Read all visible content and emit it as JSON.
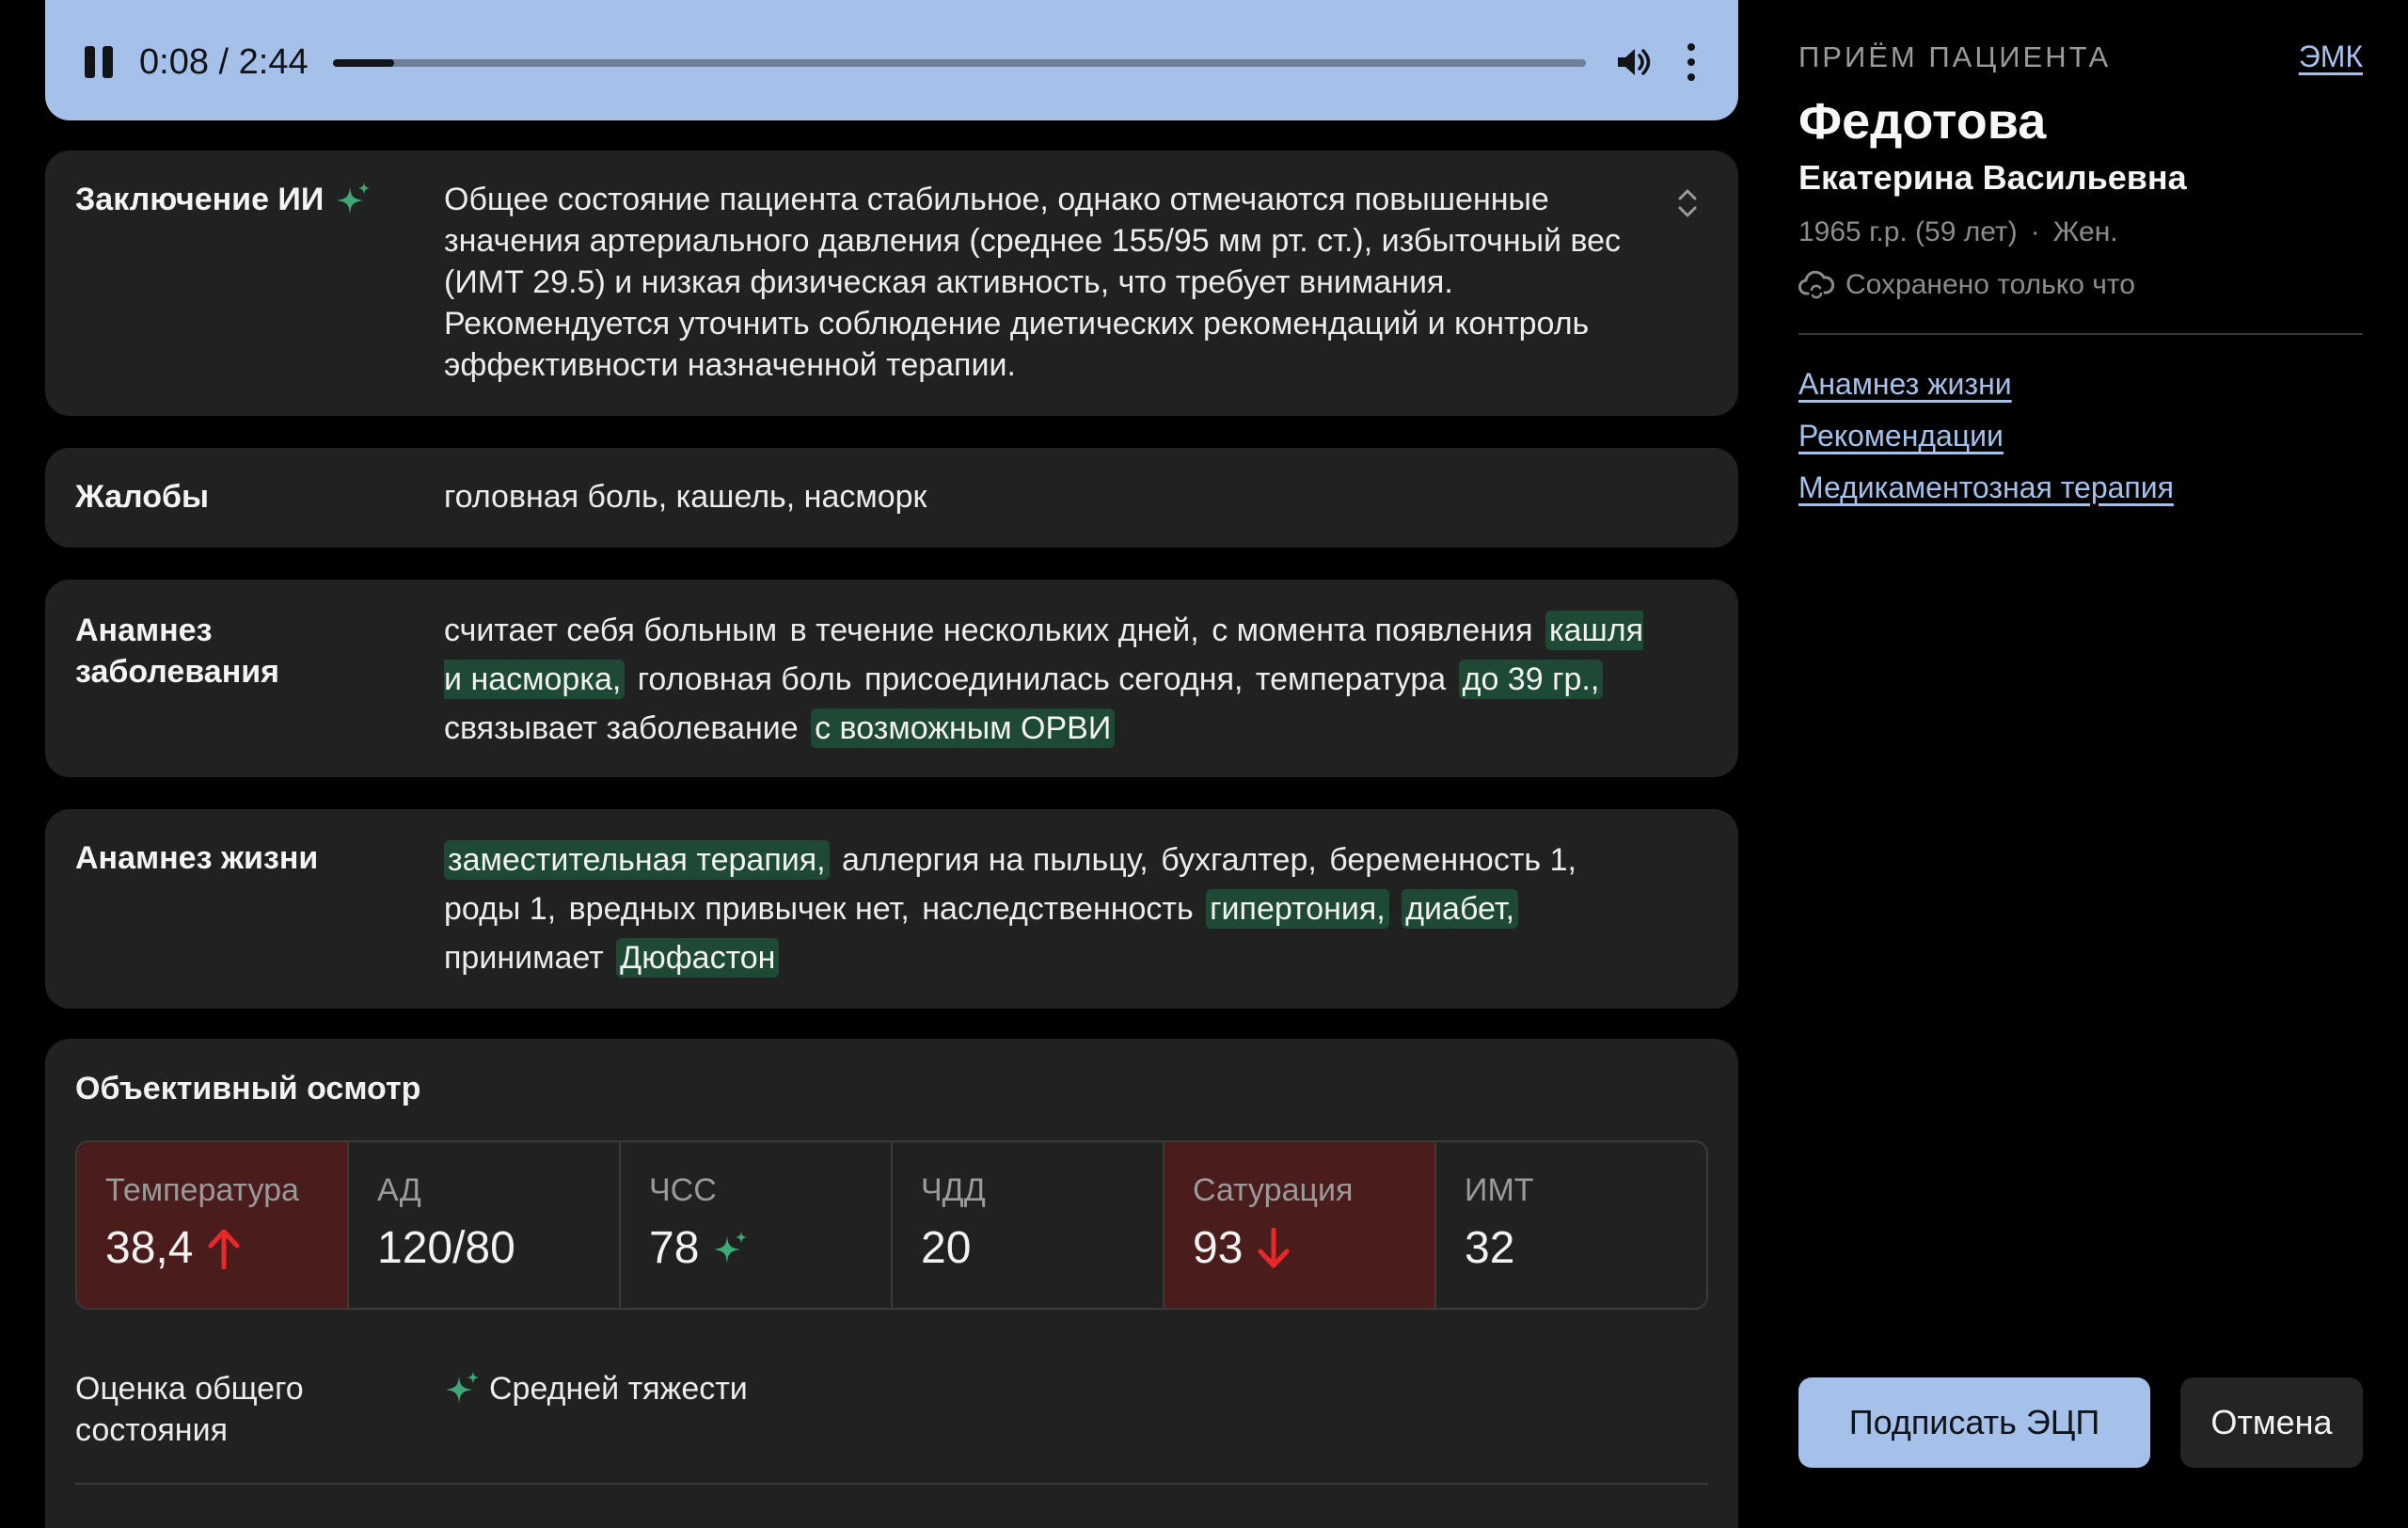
{
  "player": {
    "time": "0:08 / 2:44",
    "progress_fraction": 0.049,
    "pause_icon": "pause-icon",
    "volume_icon": "volume-icon",
    "more_icon": "more-vertical-icon"
  },
  "ai_conclusion": {
    "label": "Заключение ИИ",
    "text": "Общее состояние пациента стабильное, однако отмечаются повышенные значения артериального давления (среднее 155/95 мм рт. ст.), избыточный вес (ИМТ 29.5) и низкая физическая активность, что требует внимания. Рекомендуется уточнить соблюдение диетических рекомендаций и контроль эффективности назначенной терапии."
  },
  "complaints": {
    "label": "Жалобы",
    "text": "головная боль, кашель, насморк"
  },
  "disease_history": {
    "label": "Анамнез заболевания",
    "segments": [
      {
        "text": "считает себя больным",
        "hl": false
      },
      {
        "text": "в течение нескольких дней,",
        "hl": false
      },
      {
        "text": "с момента появления",
        "hl": false
      },
      {
        "text": "кашля и насморка,",
        "hl": true
      },
      {
        "text": "головная боль",
        "hl": false
      },
      {
        "text": "присоединилась сегодня,",
        "hl": false
      },
      {
        "text": "температура",
        "hl": false
      },
      {
        "text": "до 39 гр.,",
        "hl": true
      },
      {
        "text": "связывает заболевание",
        "hl": false
      },
      {
        "text": "с возможным ОРВИ",
        "hl": true
      }
    ]
  },
  "life_history": {
    "label": "Анамнез жизни",
    "segments": [
      {
        "text": "заместительная терапия,",
        "hl": true
      },
      {
        "text": "аллергия на пыльцу,",
        "hl": false
      },
      {
        "text": "бухгалтер,",
        "hl": false
      },
      {
        "text": "беременность 1,",
        "hl": false
      },
      {
        "text": "роды 1,",
        "hl": false
      },
      {
        "text": "вредных привычек нет,",
        "hl": false
      },
      {
        "text": "наследственность",
        "hl": false
      },
      {
        "text": "гипертония,",
        "hl": true
      },
      {
        "text": "диабет,",
        "hl": true
      },
      {
        "text": "принимает",
        "hl": false
      },
      {
        "text": "Дюфастон",
        "hl": true
      }
    ]
  },
  "exam": {
    "title": "Объективный осмотр",
    "vitals": [
      {
        "name": "Температура",
        "value": "38,4",
        "alert": true,
        "indicator": "arrow-up-icon"
      },
      {
        "name": "АД",
        "value": "120/80",
        "alert": false,
        "indicator": ""
      },
      {
        "name": "ЧСС",
        "value": "78",
        "alert": false,
        "indicator": "sparkle-icon"
      },
      {
        "name": "ЧДД",
        "value": "20",
        "alert": false,
        "indicator": ""
      },
      {
        "name": "Сатурация",
        "value": "93",
        "alert": true,
        "indicator": "arrow-down-icon"
      },
      {
        "name": "ИМТ",
        "value": "32",
        "alert": false,
        "indicator": ""
      }
    ],
    "assessment_label": "Оценка общего состояния",
    "assessment_value": "Средней тяжести"
  },
  "sidebar": {
    "kicker": "ПРИЁМ ПАЦИЕНТА",
    "emk_link": "ЭМК",
    "surname": "Федотова",
    "given_names": "Екатерина Васильевна",
    "birth": "1965 г.р. (59 лет)",
    "sep": "·",
    "sex": "Жен.",
    "saved": "Сохранено только что",
    "links": [
      "Анамнез жизни",
      "Рекомендации",
      "Медикаментозная терапия"
    ],
    "sign_button": "Подписать ЭЦП",
    "cancel_button": "Отмена"
  },
  "colors": {
    "accent": "#a5c1ea",
    "highlight": "#1e4a35",
    "sparkle": "#3fa877",
    "alert_bg": "#4a1c1c",
    "alert_arrow": "#e8292b",
    "card": "#212121"
  }
}
